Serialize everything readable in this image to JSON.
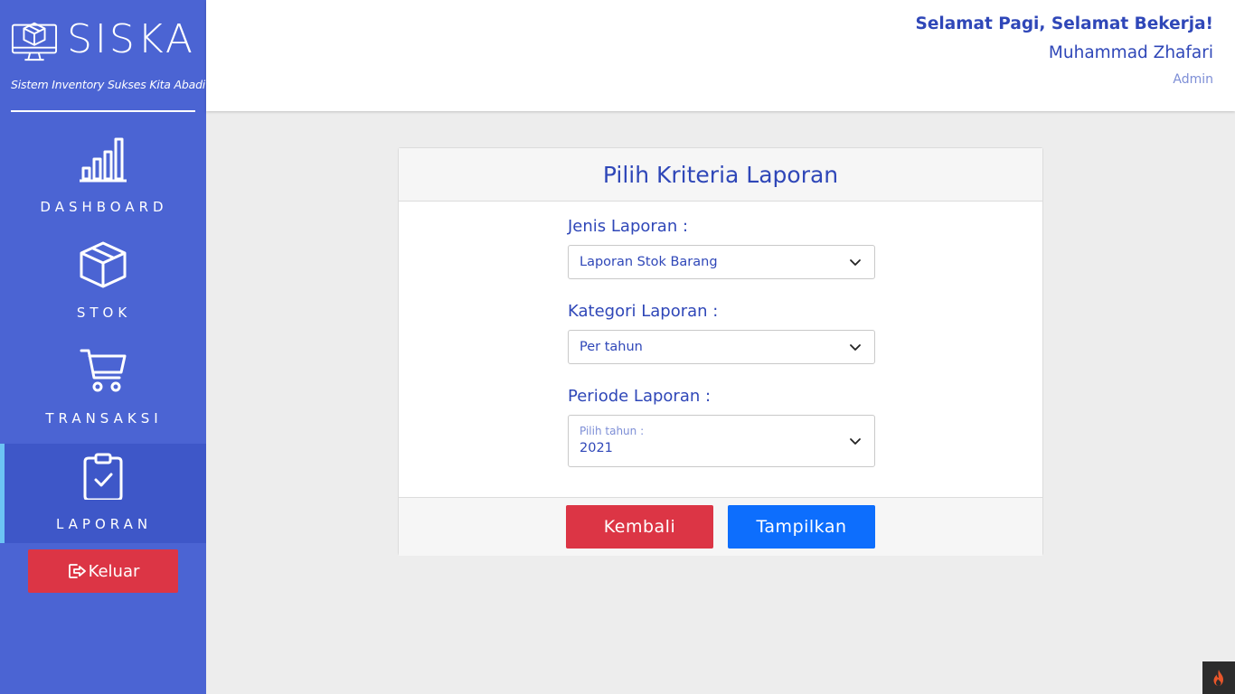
{
  "brand": {
    "name": "SISKA",
    "tagline": "Sistem Inventory Sukses Kita Abadi"
  },
  "sidebar": {
    "items": [
      {
        "label": "DASHBOARD",
        "icon": "bar-chart-icon",
        "active": false
      },
      {
        "label": "STOK",
        "icon": "box-icon",
        "active": false
      },
      {
        "label": "TRANSAKSI",
        "icon": "cart-icon",
        "active": false
      },
      {
        "label": "LAPORAN",
        "icon": "clipboard-check-icon",
        "active": true
      }
    ],
    "logout_label": "Keluar"
  },
  "header": {
    "greeting": "Selamat Pagi, Selamat Bekerja!",
    "user_name": "Muhammad Zhafari",
    "role": "Admin"
  },
  "report": {
    "title": "Pilih Kriteria Laporan",
    "jenis_label": "Jenis Laporan :",
    "jenis_value": "Laporan Stok Barang",
    "kategori_label": "Kategori Laporan :",
    "kategori_value": "Per tahun",
    "periode_label": "Periode Laporan :",
    "periode_float_label": "Pilih tahun :",
    "periode_value": "2021",
    "back_label": "Kembali",
    "show_label": "Tampilkan"
  },
  "colors": {
    "sidebar": "#4b64d3",
    "accent_text": "#2f47b8",
    "danger": "#dc3545",
    "primary": "#0d6efd"
  }
}
